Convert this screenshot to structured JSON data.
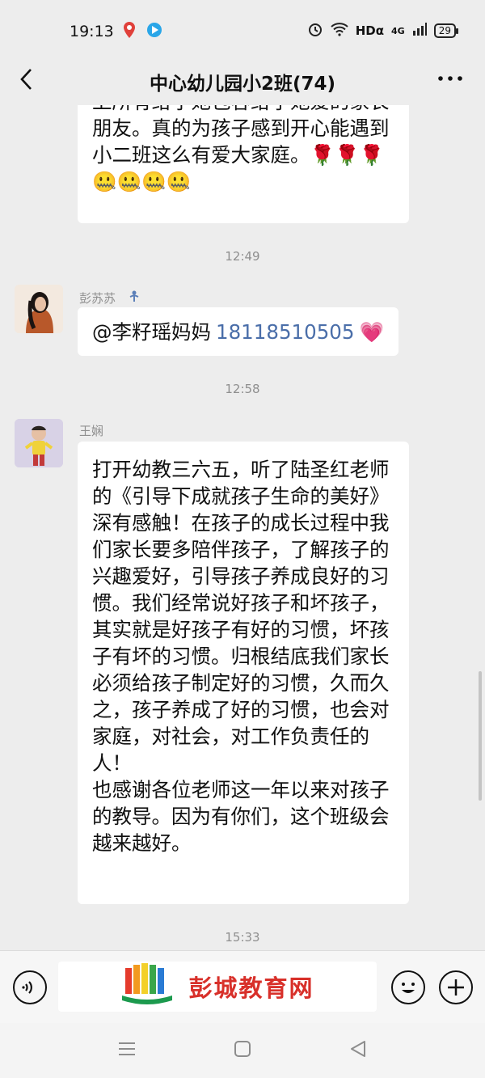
{
  "status_bar": {
    "time": "19:13",
    "network": "HDα",
    "signal": "4G",
    "battery": "29"
  },
  "header": {
    "title": "中心幼儿园小2班(74)"
  },
  "messages": {
    "top": {
      "cut_line": "上所有给予她包容给予她爱的家长",
      "text": "朋友。真的为孩子感到开心能遇到\n小二班这么有爱大家庭。🌹🌹🌹\n🤐🤐🤐🤐"
    },
    "ts1": "12:49",
    "m2": {
      "sender": "彭苏苏",
      "mention": "@李籽瑶妈妈",
      "number": "18118510505",
      "emoji": "💗"
    },
    "ts2": "12:58",
    "m3": {
      "sender": "王娴",
      "text": "打开幼教三六五，听了陆圣红老师\n的《引导下成就孩子生命的美好》\n深有感触！在孩子的成长过程中我\n们家长要多陪伴孩子，了解孩子的\n兴趣爱好，引导孩子养成良好的习\n惯。我们经常说好孩子和坏孩子，\n其实就是好孩子有好的习惯，坏孩\n子有坏的习惯。归根结底我们家长\n必须给孩子制定好的习惯，久而久\n之，孩子养成了好的习惯，也会对\n家庭，对社会，对工作负责任的\n人！\n也感谢各位老师这一年以来对孩子\n的教导。因为有你们，这个班级会\n越来越好。"
    },
    "ts3": "15:33"
  },
  "watermark": {
    "brand": "彭城教育网"
  },
  "colors": {
    "background": "#ededed",
    "bubble": "#ffffff",
    "timestamp": "#8f8f8f",
    "link_number": "#4a6ea9",
    "brand_red": "#d8302a"
  },
  "icons": [
    "back-icon",
    "more-icon",
    "voice-icon",
    "emoji-icon",
    "plus-icon",
    "menu-icon",
    "home-icon",
    "back-nav-icon",
    "alarm-icon",
    "wifi-icon",
    "map-pin-icon",
    "video-icon"
  ]
}
